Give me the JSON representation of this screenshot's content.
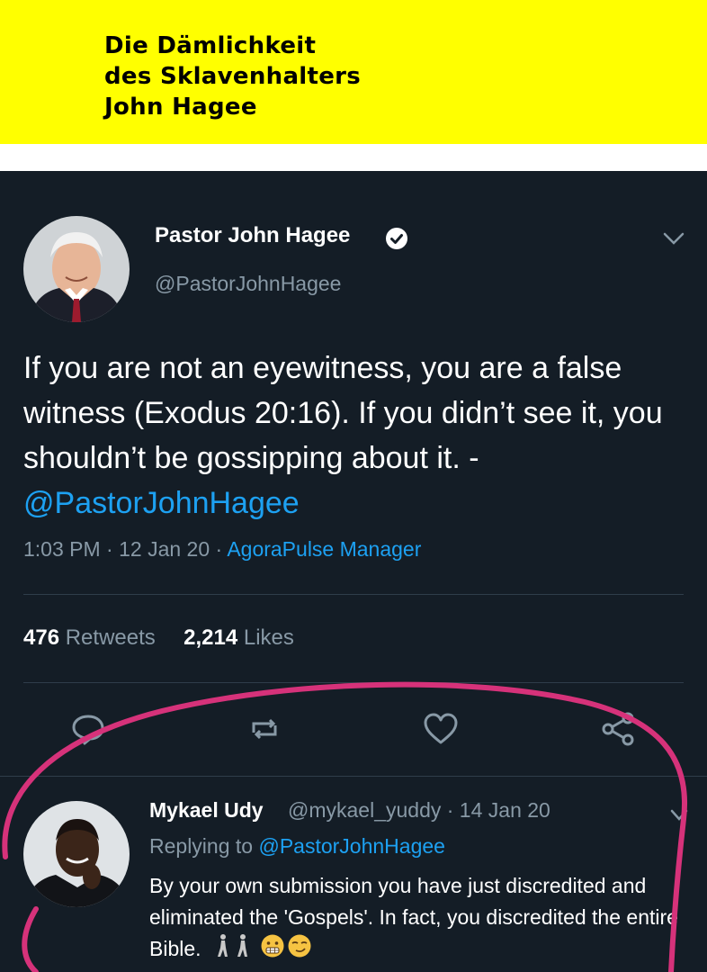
{
  "banner": {
    "title": "Die Dämlichkeit\ndes Sklavenhalters\nJohn Hagee",
    "background": "#ffff00"
  },
  "tweet": {
    "author_name": "Pastor John Hagee",
    "author_handle": "@PastorJohnHagee",
    "verified_icon": "verified-badge-icon",
    "menu_icon": "chevron-down-icon",
    "body_text": "If you are not an eyewitness, you are a false witness (Exodus 20:16). If you didn’t see it, you shouldn’t be gossipping about it. - ",
    "body_mention": "@PastorJohnHagee",
    "time": "1:03 PM",
    "date": "12 Jan 20",
    "source": "AgoraPulse Manager",
    "retweets_count": "476",
    "retweets_label": "Retweets",
    "likes_count": "2,214",
    "likes_label": "Likes",
    "actions": [
      "reply-icon",
      "retweet-icon",
      "like-icon",
      "share-icon"
    ]
  },
  "reply": {
    "author_name": "Mykael Udy",
    "author_handle_date": "@mykael_yuddy · 14 Jan 20",
    "replying_prefix": "Replying to",
    "replying_to": "@PastorJohnHagee",
    "body_text": "By your own submission you have just discredited and eliminated the 'Gospels'. In fact, you discredited the entire Bible.",
    "emojis": [
      "person-walking-emoji",
      "person-walking-emoji",
      "grimacing-face-emoji",
      "smirking-face-emoji"
    ]
  },
  "colors": {
    "card_background": "#141d26",
    "link": "#1da1f2",
    "secondary_text": "#8899a6",
    "annotation_circle": "#d6327a"
  }
}
